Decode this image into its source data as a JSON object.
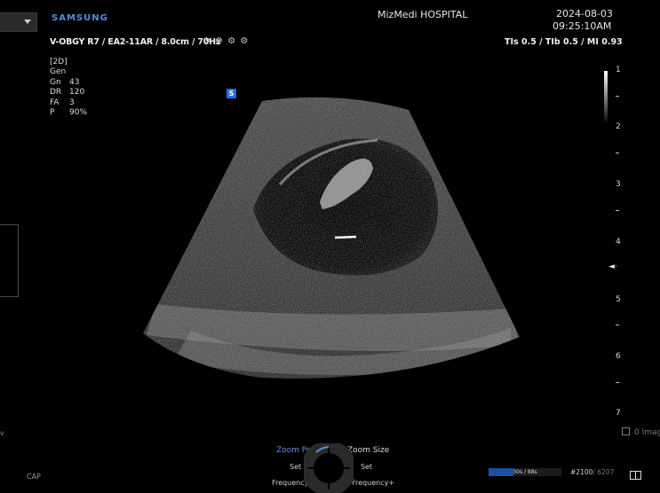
{
  "header": {
    "brand": "SAMSUNG",
    "hospital": "MizMedi HOSPITAL",
    "date": "2024-08-03",
    "time": "09:25:10AM",
    "probe_info": "V-OBGY R7 / EA2-11AR / 8.0cm / 70Hz",
    "indices": "TIs  0.5 / TIb  0.5 / MI  0.93"
  },
  "params": {
    "mode": "[2D]",
    "rows": [
      {
        "k": "Gen",
        "v": ""
      },
      {
        "k": "Gn",
        "v": "43"
      },
      {
        "k": "DR",
        "v": "120"
      },
      {
        "k": "FA",
        "v": "3"
      },
      {
        "k": "P",
        "v": "90%"
      }
    ]
  },
  "markers": {
    "orientation": "S"
  },
  "depth_scale": [
    "1",
    "2",
    "3",
    "4",
    "5",
    "6",
    "7"
  ],
  "footer": {
    "zoom_position": "Zoom Position",
    "zoom_size": "Zoom Size",
    "set_left": "Set",
    "set_right": "Set",
    "frequency_minus": "Frequency-",
    "frequency_plus": "Frequency+",
    "cine_text": "30s / 88s",
    "cine_progress": 0.34,
    "frame_current": "#2100",
    "frame_total": "/ 6207",
    "image_count": "0 Imag",
    "cap": "CAP",
    "left_v": "v"
  },
  "colors": {
    "brand": "#4f8fd8",
    "accent": "#2c6ad6",
    "zoom_active": "#5d8fe0"
  }
}
